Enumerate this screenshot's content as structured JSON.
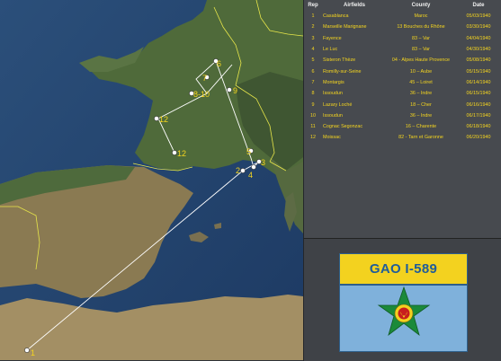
{
  "table": {
    "headers": {
      "rep": "Rep",
      "airfield": "Airfields",
      "county": "County",
      "date": "Date"
    },
    "rows": [
      {
        "rep": "1",
        "airfield": "Casablanca",
        "county": "Maroc",
        "date": "05/03/1940"
      },
      {
        "rep": "2",
        "airfield": "Marseille Marignane",
        "county": "13   Bouches du  Rhône",
        "date": "03/30/1940"
      },
      {
        "rep": "3",
        "airfield": "Fayence",
        "county": "83 – Var",
        "date": "04/04/1940"
      },
      {
        "rep": "4",
        "airfield": "Le Luc",
        "county": "83 – Var",
        "date": "04/30/1940"
      },
      {
        "rep": "5",
        "airfield": "Sisteron Thèze",
        "county": "04 - Alpes Haute Provence",
        "date": "05/08/1940"
      },
      {
        "rep": "6",
        "airfield": "Romilly-sur-Seine",
        "county": "10 – Aube",
        "date": "05/15/1940"
      },
      {
        "rep": "7",
        "airfield": "Montargis",
        "county": "45 – Loiret",
        "date": "06/14/1940"
      },
      {
        "rep": "8",
        "airfield": "Issoudun",
        "county": "36 – Indre",
        "date": "06/15/1940"
      },
      {
        "rep": "9",
        "airfield": "Lazary Loché",
        "county": "18 – Cher",
        "date": "06/16/1940"
      },
      {
        "rep": "10",
        "airfield": "Issoudun",
        "county": "36 – Indre",
        "date": "06/17/1940"
      },
      {
        "rep": "11",
        "airfield": "Cognac Segonzac",
        "county": "16 – Charente",
        "date": "06/18/1940"
      },
      {
        "rep": "12",
        "airfield": "Moissac",
        "county": "82 - Tarn et Garonne",
        "date": "06/20/1940"
      }
    ]
  },
  "flag": {
    "title": "GAO I-589"
  },
  "map": {
    "markers": [
      {
        "id": "1",
        "label": "1"
      },
      {
        "id": "2",
        "label": "2"
      },
      {
        "id": "3",
        "label": "3"
      },
      {
        "id": "4",
        "label": "4"
      },
      {
        "id": "5",
        "label": "5"
      },
      {
        "id": "6",
        "label": "6"
      },
      {
        "id": "7",
        "label": "7"
      },
      {
        "id": "8-10",
        "label": "8-10"
      },
      {
        "id": "9",
        "label": "9"
      },
      {
        "id": "11",
        "label": "11"
      },
      {
        "id": "12",
        "label": "12"
      }
    ]
  },
  "colors": {
    "label": "#f5d51f",
    "route": "#ffffff",
    "flag_band": "#f3d21f",
    "flag_field": "#7fb1db",
    "star": "#1b8a3a",
    "title_text": "#1f5c9a"
  }
}
